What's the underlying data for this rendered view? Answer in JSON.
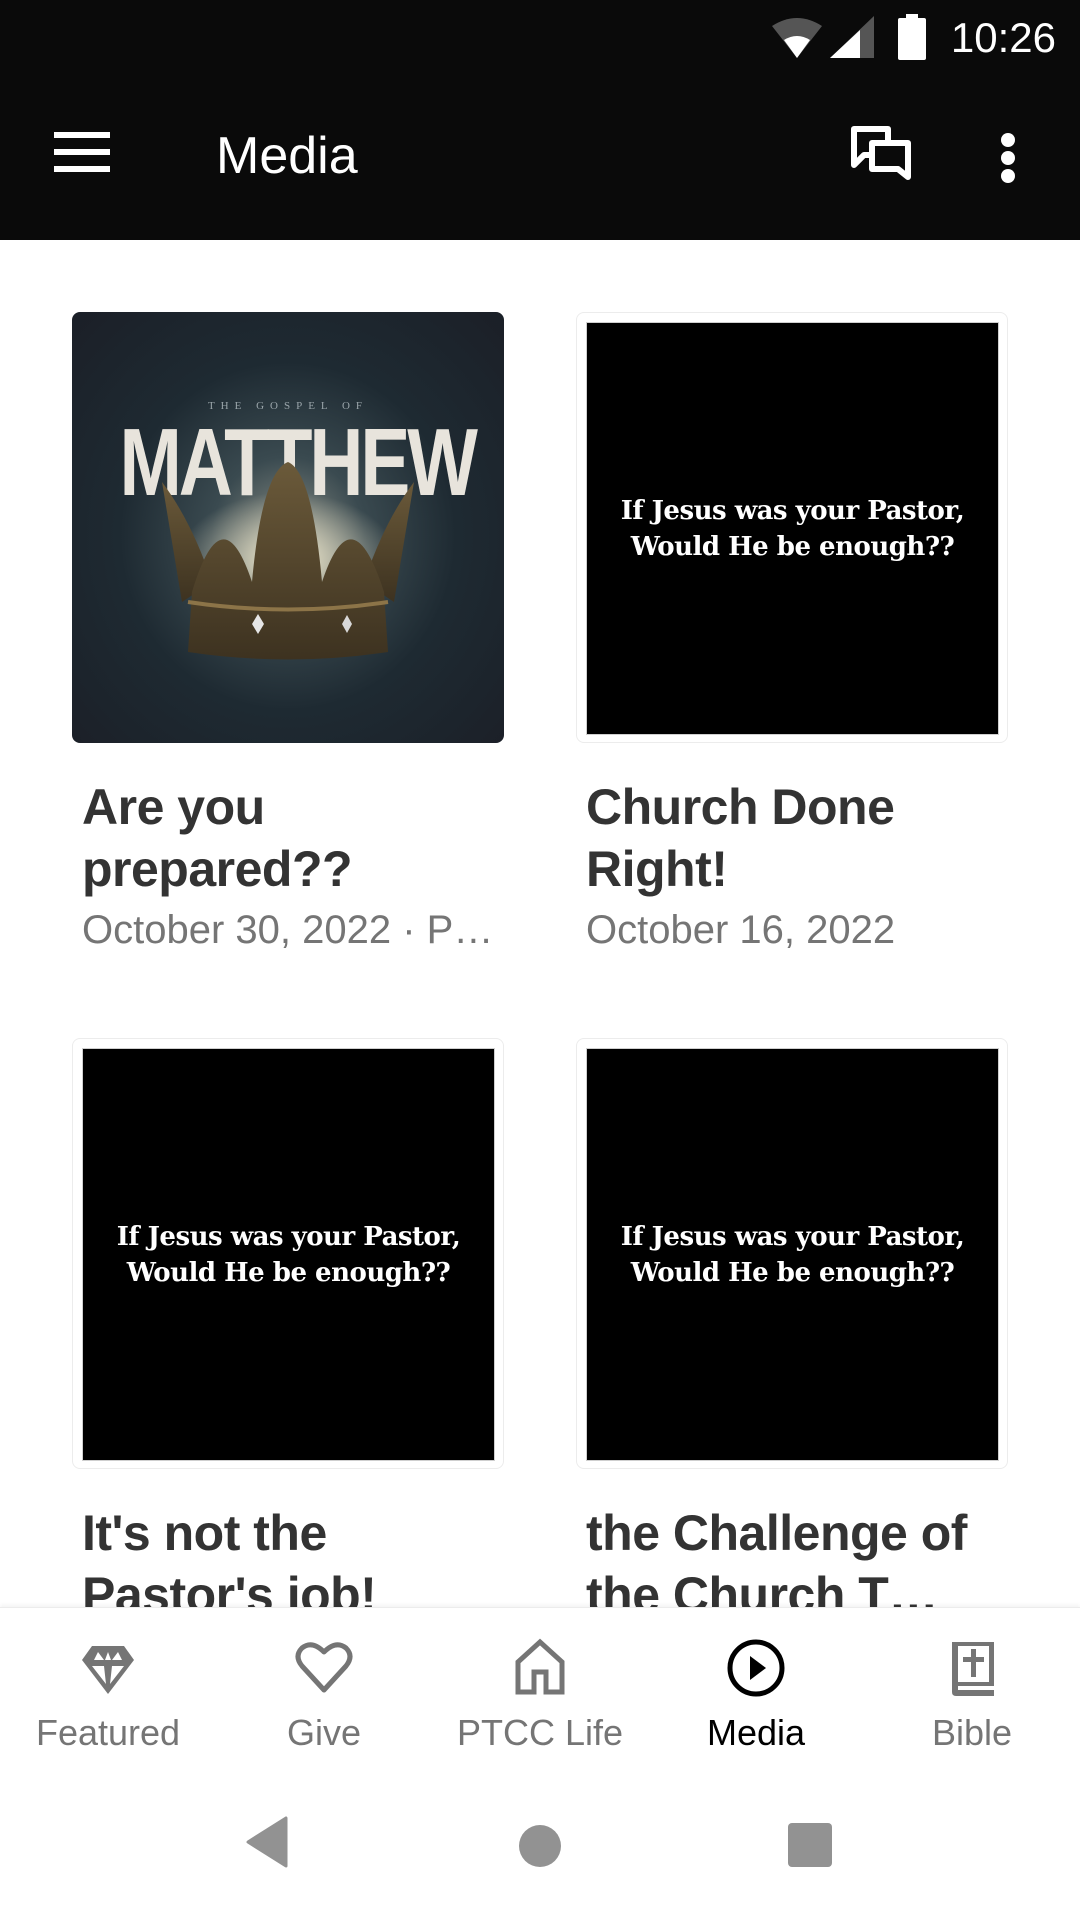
{
  "status_bar": {
    "time": "10:26",
    "wifi_icon": "wifi-icon",
    "signal_icon": "cell-signal-icon",
    "battery_icon": "battery-icon"
  },
  "app_bar": {
    "title": "Media",
    "menu_icon": "hamburger-menu-icon",
    "chat_icon": "chat-bubbles-icon",
    "more_icon": "more-vertical-icon"
  },
  "media_items": [
    {
      "title": "Are you prepared??",
      "subtitle": "October 30, 2022 · P…",
      "thumbnail": {
        "kind": "artwork",
        "overline": "THE GOSPEL OF",
        "headline": "MATTHEW"
      }
    },
    {
      "title": "Church Done Right!",
      "subtitle": "October 16, 2022",
      "thumbnail": {
        "kind": "quote",
        "line1": "If Jesus was your Pastor,",
        "line2": "Would He be  enough??"
      }
    },
    {
      "title": "It's not the Pastor's job!",
      "subtitle": "",
      "thumbnail": {
        "kind": "quote",
        "line1": "If Jesus was your Pastor,",
        "line2": "Would He be  enough??"
      }
    },
    {
      "title": "the Challenge of the Church T…",
      "subtitle": "",
      "thumbnail": {
        "kind": "quote",
        "line1": "If Jesus was your Pastor,",
        "line2": "Would He be  enough??"
      }
    }
  ],
  "bottom_nav": {
    "active": "Media",
    "active_color": "#000000",
    "inactive_color": "#757575",
    "tabs": [
      {
        "label": "Featured",
        "icon": "diamond-icon"
      },
      {
        "label": "Give",
        "icon": "heart-icon"
      },
      {
        "label": "PTCC Life",
        "icon": "home-icon"
      },
      {
        "label": "Media",
        "icon": "play-circle-icon"
      },
      {
        "label": "Bible",
        "icon": "bible-icon"
      }
    ]
  },
  "system_nav": {
    "back": "back-icon",
    "home": "home-circle-icon",
    "recents": "recents-icon"
  }
}
